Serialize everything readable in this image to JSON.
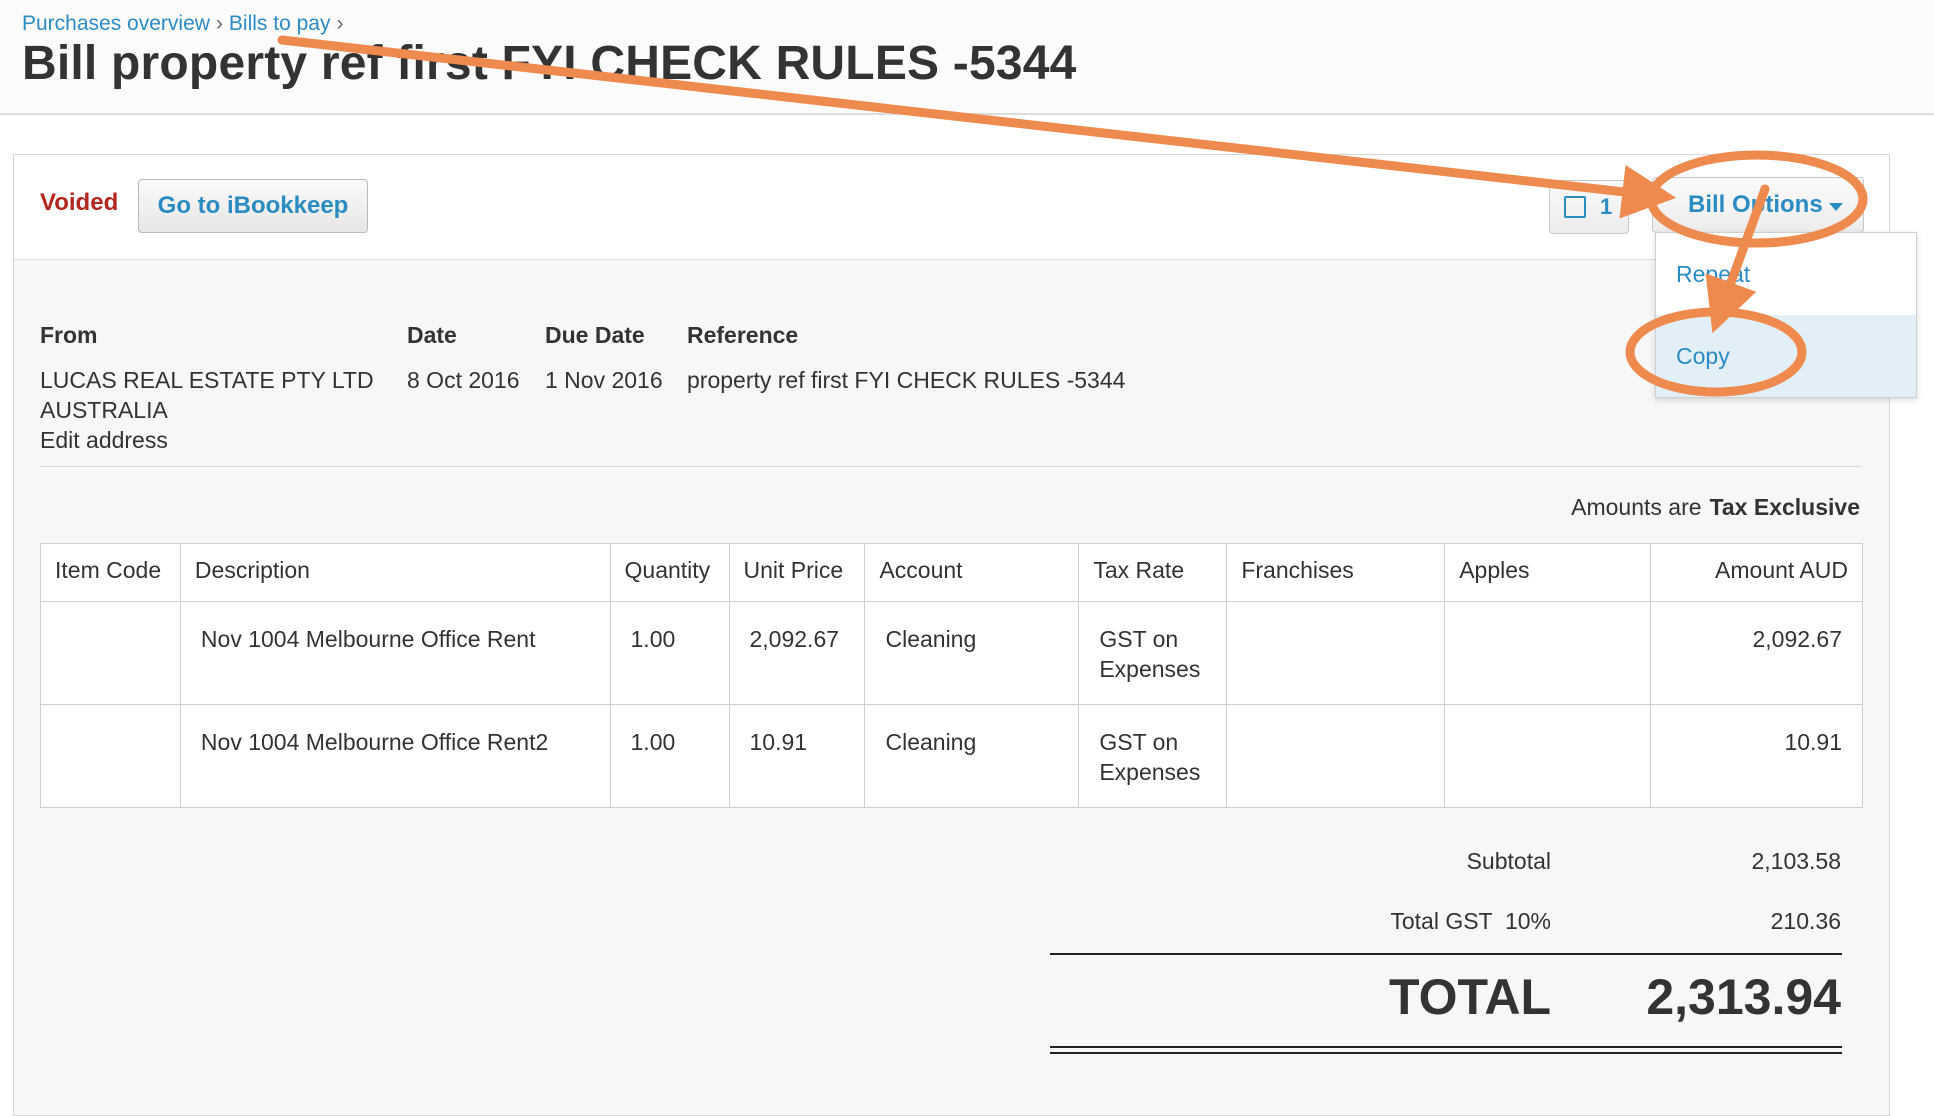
{
  "breadcrumb": {
    "items": [
      "Purchases overview",
      "Bills to pay"
    ],
    "separator": "›"
  },
  "page_title": "Bill property ref first FYI CHECK RULES -5344",
  "status": {
    "text": "Voided",
    "color": "#b3261e"
  },
  "actions": {
    "goto_label": "Go to iBookkeep",
    "print_count": "1",
    "options_label": "Bill Options",
    "dropdown": [
      "Repeat",
      "Copy"
    ],
    "highlighted_item": "Copy"
  },
  "info": {
    "from_label": "From",
    "date_label": "Date",
    "due_label": "Due Date",
    "ref_label": "Reference",
    "from_name": "LUCAS REAL ESTATE PTY LTD",
    "from_country": "AUSTRALIA",
    "edit_address": "Edit address",
    "date": "8 Oct 2016",
    "due_date": "1 Nov 2016",
    "reference": "property ref first FYI CHECK RULES -5344"
  },
  "amounts_are": {
    "label": "Amounts are",
    "value": "Tax Exclusive"
  },
  "table": {
    "headers": [
      "Item Code",
      "Description",
      "Quantity",
      "Unit Price",
      "Account",
      "Tax Rate",
      "Franchises",
      "Apples",
      "Amount AUD"
    ],
    "rows": [
      {
        "item_code": "",
        "description": "Nov 1004 Melbourne Office Rent",
        "quantity": "1.00",
        "unit_price": "2,092.67",
        "account": "Cleaning",
        "tax_rate_1": "GST on",
        "tax_rate_2": "Expenses",
        "franchises": "",
        "apples": "",
        "amount": "2,092.67"
      },
      {
        "item_code": "",
        "description": "Nov 1004 Melbourne Office Rent2",
        "quantity": "1.00",
        "unit_price": "10.91",
        "account": "Cleaning",
        "tax_rate_1": "GST on",
        "tax_rate_2": "Expenses",
        "franchises": "",
        "apples": "",
        "amount": "10.91"
      }
    ]
  },
  "totals": {
    "subtotal_label": "Subtotal",
    "subtotal": "2,103.58",
    "gst_label": "Total GST  10%",
    "gst": "210.36",
    "total_label": "TOTAL",
    "total": "2,313.94"
  },
  "colors": {
    "link": "#2b8cc4",
    "annotation": "#ef8a4f",
    "voided": "#b3261e"
  }
}
